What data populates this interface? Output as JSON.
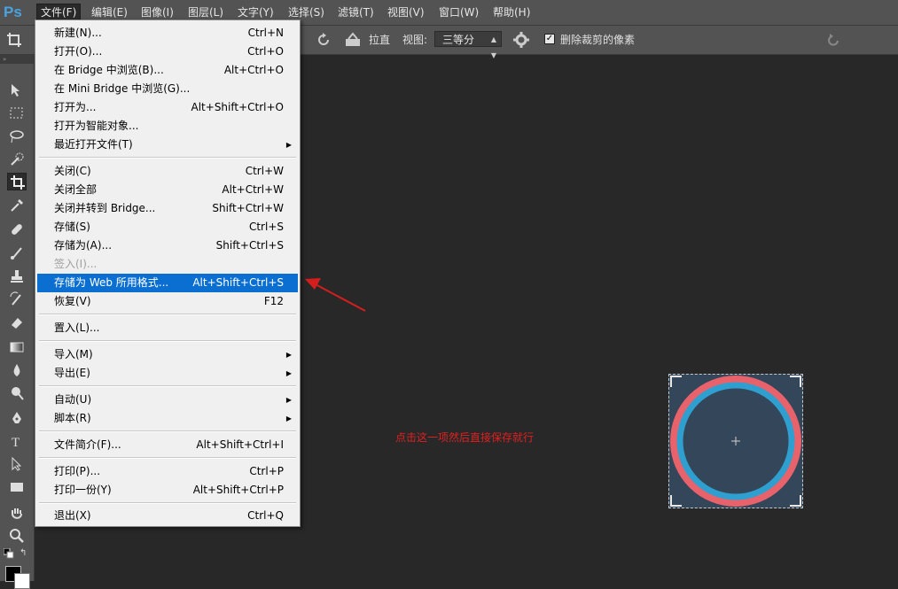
{
  "app": {
    "logo": "Ps"
  },
  "menubar": {
    "items": [
      "文件(F)",
      "编辑(E)",
      "图像(I)",
      "图层(L)",
      "文字(Y)",
      "选择(S)",
      "滤镜(T)",
      "视图(V)",
      "窗口(W)",
      "帮助(H)"
    ],
    "active_index": 0
  },
  "options_bar": {
    "straighten_label": "拉直",
    "view_label": "视图:",
    "view_value": "三等分",
    "delete_cropped_label": "删除裁剪的像素",
    "delete_cropped_checked": true
  },
  "toolbar": {
    "tools": [
      "move-icon",
      "marquee-icon",
      "lasso-icon",
      "quick-select-icon",
      "crop-icon",
      "eyedropper-icon",
      "healing-icon",
      "brush-icon",
      "clone-stamp-icon",
      "history-brush-icon",
      "eraser-icon",
      "gradient-icon",
      "blur-icon",
      "dodge-icon",
      "pen-icon",
      "type-icon",
      "path-select-icon",
      "shape-icon",
      "hand-icon",
      "zoom-icon"
    ],
    "selected": "crop-icon",
    "foreground_color": "#000000",
    "background_color": "#ffffff"
  },
  "file_menu": {
    "items": [
      {
        "label": "新建(N)...",
        "shortcut": "Ctrl+N"
      },
      {
        "label": "打开(O)...",
        "shortcut": "Ctrl+O"
      },
      {
        "label": "在 Bridge 中浏览(B)...",
        "shortcut": "Alt+Ctrl+O"
      },
      {
        "label": "在 Mini Bridge 中浏览(G)...",
        "shortcut": ""
      },
      {
        "label": "打开为...",
        "shortcut": "Alt+Shift+Ctrl+O"
      },
      {
        "label": "打开为智能对象...",
        "shortcut": ""
      },
      {
        "label": "最近打开文件(T)",
        "shortcut": "",
        "submenu": true
      },
      {
        "label": "关闭(C)",
        "shortcut": "Ctrl+W"
      },
      {
        "label": "关闭全部",
        "shortcut": "Alt+Ctrl+W"
      },
      {
        "label": "关闭并转到 Bridge...",
        "shortcut": "Shift+Ctrl+W"
      },
      {
        "label": "存储(S)",
        "shortcut": "Ctrl+S"
      },
      {
        "label": "存储为(A)...",
        "shortcut": "Shift+Ctrl+S"
      },
      {
        "label": "签入(I)...",
        "shortcut": "",
        "disabled": true
      },
      {
        "label": "存储为 Web 所用格式...",
        "shortcut": "Alt+Shift+Ctrl+S",
        "highlighted": true
      },
      {
        "label": "恢复(V)",
        "shortcut": "F12"
      },
      {
        "label": "置入(L)...",
        "shortcut": ""
      },
      {
        "label": "导入(M)",
        "shortcut": "",
        "submenu": true
      },
      {
        "label": "导出(E)",
        "shortcut": "",
        "submenu": true
      },
      {
        "label": "自动(U)",
        "shortcut": "",
        "submenu": true
      },
      {
        "label": "脚本(R)",
        "shortcut": "",
        "submenu": true
      },
      {
        "label": "文件简介(F)...",
        "shortcut": "Alt+Shift+Ctrl+I"
      },
      {
        "label": "打印(P)...",
        "shortcut": "Ctrl+P"
      },
      {
        "label": "打印一份(Y)",
        "shortcut": "Alt+Shift+Ctrl+P"
      },
      {
        "label": "退出(X)",
        "shortcut": "Ctrl+Q"
      }
    ]
  },
  "canvas": {
    "annotation": "点击这一项然后直接保存就行",
    "annotation_color": "#e02020",
    "thumbnail_bg": "#34465a",
    "ring_outer_color": "#e8626b",
    "ring_inner_color": "#2f9fd0"
  }
}
